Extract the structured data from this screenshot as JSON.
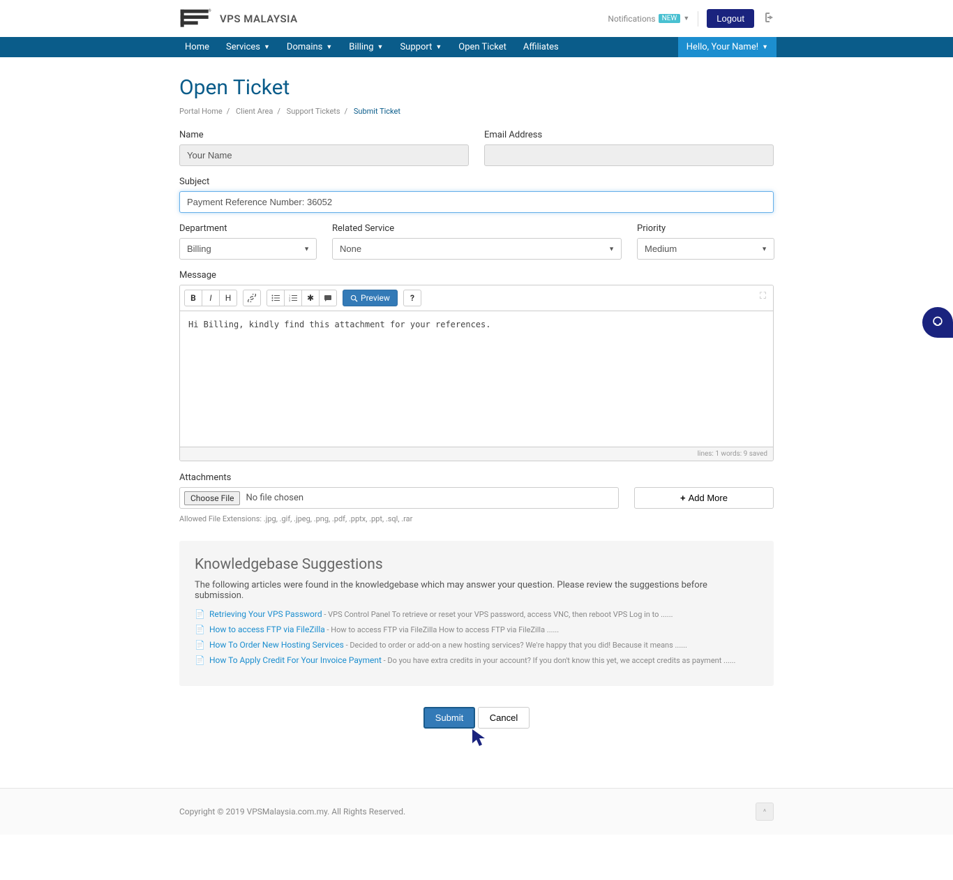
{
  "header": {
    "brand": "VPS MALAYSIA",
    "notifications_label": "Notifications",
    "new_badge": "NEW",
    "logout": "Logout"
  },
  "nav": {
    "home": "Home",
    "services": "Services",
    "domains": "Domains",
    "billing": "Billing",
    "support": "Support",
    "open_ticket": "Open Ticket",
    "affiliates": "Affiliates",
    "hello": "Hello, Your Name!"
  },
  "page": {
    "title": "Open Ticket"
  },
  "breadcrumb": {
    "portal": "Portal Home",
    "client": "Client Area",
    "tickets": "Support Tickets",
    "submit": "Submit Ticket"
  },
  "form": {
    "name_label": "Name",
    "name_value": "Your Name",
    "email_label": "Email Address",
    "email_value": "",
    "subject_label": "Subject",
    "subject_value": "Payment Reference Number: 36052",
    "department_label": "Department",
    "department_value": "Billing",
    "service_label": "Related Service",
    "service_value": "None",
    "priority_label": "Priority",
    "priority_value": "Medium",
    "message_label": "Message",
    "message_value": "Hi Billing, kindly find this attachment for your references.",
    "preview": "Preview",
    "status": "lines: 1   words: 9   saved",
    "attachments_label": "Attachments",
    "choose_file": "Choose File",
    "no_file": "No file chosen",
    "add_more": "Add More",
    "allowed": "Allowed File Extensions: .jpg, .gif, .jpeg, .png, .pdf, .pptx, .ppt, .sql, .rar"
  },
  "kb": {
    "title": "Knowledgebase Suggestions",
    "intro": "The following articles were found in the knowledgebase which may answer your question. Please review the suggestions before submission.",
    "items": [
      {
        "title": "Retrieving Your VPS Password",
        "desc": " - VPS Control Panel To retrieve or reset your VPS password, access VNC, then reboot VPS Log in to ......"
      },
      {
        "title": "How to access FTP via FileZilla",
        "desc": " - How to access FTP via FileZilla   How to access FTP via FileZilla ......"
      },
      {
        "title": "How To Order New Hosting Services",
        "desc": " - Decided to order or add-on a new hosting services? We're happy that you did! Because it means ......"
      },
      {
        "title": "How To Apply Credit For Your Invoice Payment",
        "desc": " - Do you have extra credits in your account? If you don't know this yet, we accept credits as payment ......"
      }
    ]
  },
  "actions": {
    "submit": "Submit",
    "cancel": "Cancel"
  },
  "footer": {
    "copyright": "Copyright © 2019 VPSMalaysia.com.my. All Rights Reserved."
  }
}
